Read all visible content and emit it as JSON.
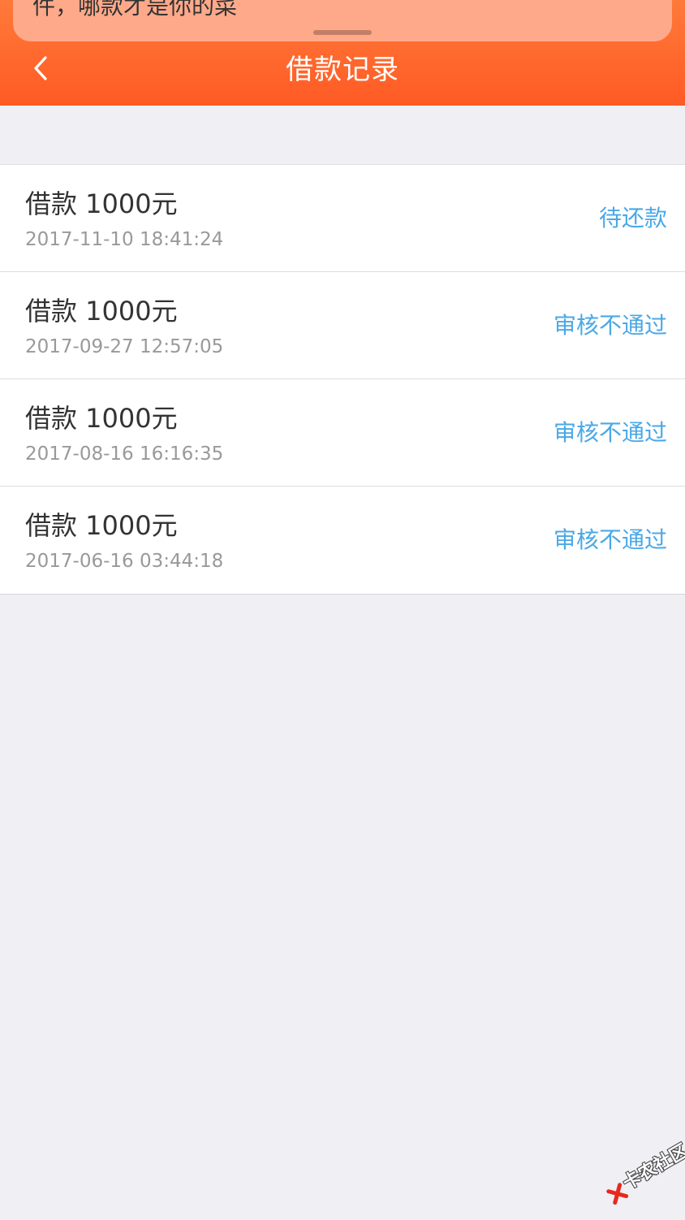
{
  "notification": {
    "text": "件，哪款才是你的菜"
  },
  "header": {
    "title": "借款记录",
    "background": "#ff5a24"
  },
  "records": [
    {
      "title": "借款 1000元",
      "date": "2017-11-10 18:41:24",
      "status": "待还款"
    },
    {
      "title": "借款 1000元",
      "date": "2017-09-27 12:57:05",
      "status": "审核不通过"
    },
    {
      "title": "借款 1000元",
      "date": "2017-08-16 16:16:35",
      "status": "审核不通过"
    },
    {
      "title": "借款 1000元",
      "date": "2017-06-16 03:44:18",
      "status": "审核不通过"
    }
  ],
  "watermark": {
    "text": "卡农社区"
  },
  "colors": {
    "accent": "#ff5a24",
    "status_text": "#4aa8e6",
    "page_background": "#efeff4"
  }
}
